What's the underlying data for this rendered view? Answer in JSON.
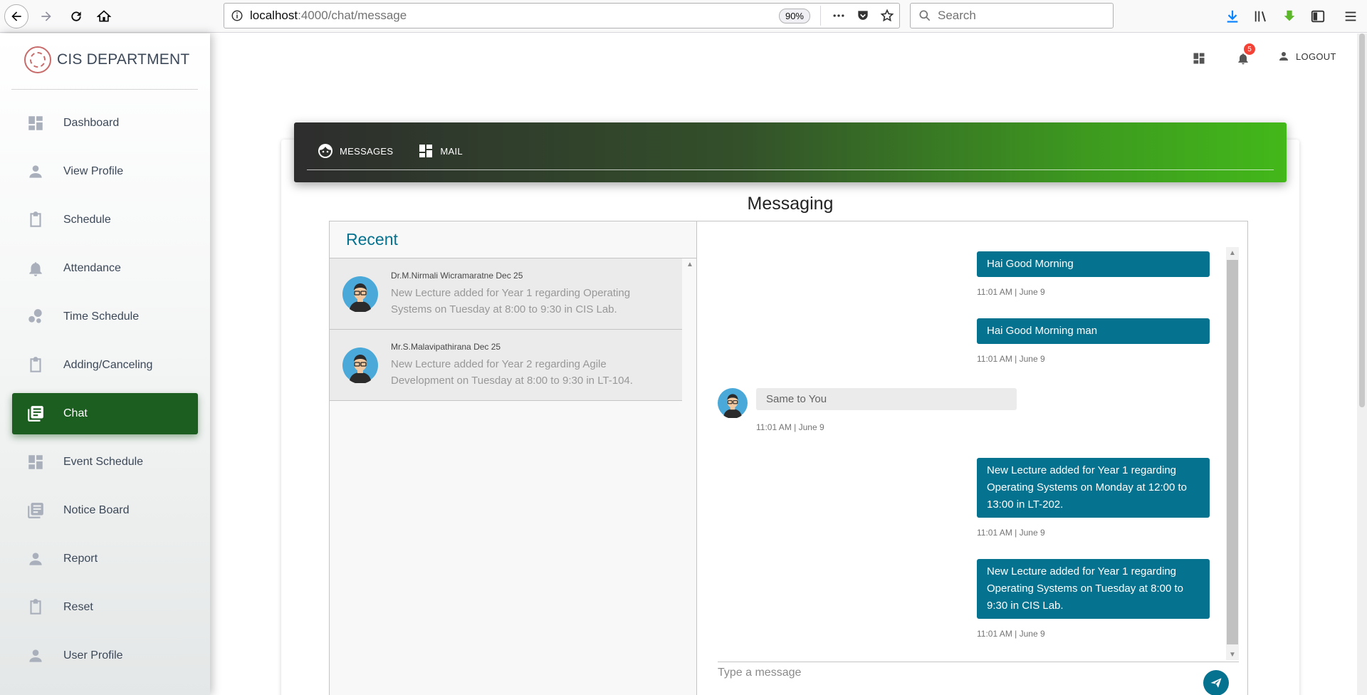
{
  "browser": {
    "url_host": "localhost",
    "url_rest": ":4000/chat/message",
    "zoom": "90%",
    "search_placeholder": "Search"
  },
  "sidebar": {
    "brand": "CIS DEPARTMENT",
    "items": [
      {
        "label": "Dashboard",
        "icon": "dashboard-icon"
      },
      {
        "label": "View Profile",
        "icon": "person-icon"
      },
      {
        "label": "Schedule",
        "icon": "clipboard-icon"
      },
      {
        "label": "Attendance",
        "icon": "bell-icon"
      },
      {
        "label": "Time Schedule",
        "icon": "bubble-chart-icon"
      },
      {
        "label": "Adding/Canceling",
        "icon": "clipboard-icon"
      },
      {
        "label": "Chat",
        "icon": "library-books-icon",
        "active": true
      },
      {
        "label": "Event Schedule",
        "icon": "dashboard-icon"
      },
      {
        "label": "Notice Board",
        "icon": "library-books-icon"
      },
      {
        "label": "Report",
        "icon": "person-icon"
      },
      {
        "label": "Reset",
        "icon": "clipboard-icon"
      },
      {
        "label": "User Profile",
        "icon": "person-icon"
      }
    ]
  },
  "header": {
    "notification_count": "5",
    "logout_label": "LOGOUT"
  },
  "card": {
    "tabs": [
      {
        "label": "MESSAGES",
        "icon": "face-icon"
      },
      {
        "label": "MAIL",
        "icon": "dashboard-icon"
      }
    ],
    "title": "Messaging"
  },
  "recent": {
    "title": "Recent",
    "chats": [
      {
        "name": "Dr.M.Nirmali Wicramaratne",
        "date": "Dec 25",
        "preview": "New Lecture added for Year 1 regarding Operating Systems on Tuesday at 8:00 to 9:30 in CIS Lab."
      },
      {
        "name": "Mr.S.Malavipathirana",
        "date": "Dec 25",
        "preview": "New Lecture added for Year 2 regarding Agile Development on Tuesday at 8:00 to 9:30 in LT-104."
      }
    ]
  },
  "messages": [
    {
      "direction": "out",
      "text": "Hai Good Morning",
      "time": "11:01 AM | June 9"
    },
    {
      "direction": "out",
      "text": "Hai Good Morning man",
      "time": "11:01 AM | June 9"
    },
    {
      "direction": "in",
      "text": "Same to You",
      "time": "11:01 AM | June 9"
    },
    {
      "direction": "out",
      "text": "New Lecture added for Year 1 regarding Operating Systems on Monday at 12:00 to 13:00 in LT-202.",
      "time": "11:01 AM | June 9"
    },
    {
      "direction": "out",
      "text": "New Lecture added for Year 1 regarding Operating Systems on Tuesday at 8:00 to 9:30 in CIS Lab.",
      "time": "11:01 AM | June 9"
    }
  ],
  "composer": {
    "placeholder": "Type a message"
  },
  "colors": {
    "active_menu": "#1b5e20",
    "bubble_out": "#05728f",
    "recent_title": "#05728f",
    "badge": "#f44336"
  }
}
